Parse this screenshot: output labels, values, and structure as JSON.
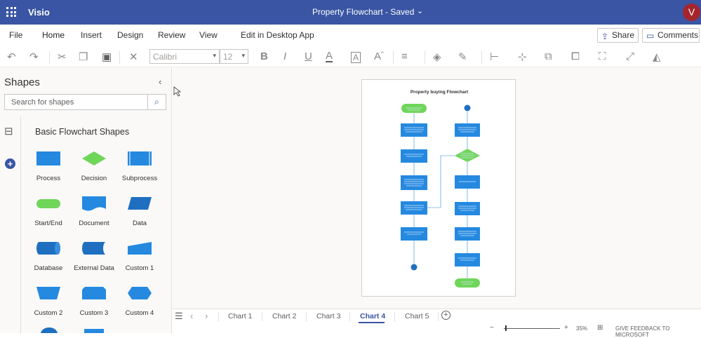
{
  "titlebar": {
    "app_name": "Visio",
    "doc_title": "Property Flowchart - Saved",
    "avatar_initial": "V",
    "avatar_color": "#a4262c",
    "bar_color": "#3955a3"
  },
  "menu": {
    "items": [
      "File",
      "Home",
      "Insert",
      "Design",
      "Review",
      "View",
      "Edit in Desktop App"
    ],
    "active": "Home",
    "share_label": "Share",
    "comments_label": "Comments"
  },
  "toolbar": {
    "font_name": "Calibri",
    "font_size": "12",
    "icons": [
      "undo-icon",
      "redo-icon",
      "cut-icon",
      "copy-icon",
      "paste-icon",
      "delete-icon",
      "bold-icon",
      "italic-icon",
      "underline-icon",
      "font-color-icon",
      "text-box-icon",
      "grow-font-icon",
      "align-icon",
      "fill-icon",
      "line-color-icon",
      "position-icon",
      "align-shapes-icon",
      "arrange-icon",
      "group-icon",
      "size-icon",
      "rotate-icon",
      "style-icon"
    ]
  },
  "sidebar": {
    "title": "Shapes",
    "search_placeholder": "Search for shapes",
    "stencil_title": "Basic Flowchart Shapes",
    "shapes": [
      {
        "label": "Process"
      },
      {
        "label": "Decision"
      },
      {
        "label": "Subprocess"
      },
      {
        "label": "Start/End"
      },
      {
        "label": "Document"
      },
      {
        "label": "Data"
      },
      {
        "label": "Database"
      },
      {
        "label": "External Data"
      },
      {
        "label": "Custom 1"
      },
      {
        "label": "Custom 2"
      },
      {
        "label": "Custom 3"
      },
      {
        "label": "Custom 4"
      }
    ]
  },
  "canvas": {
    "diagram_title": "Property buying Flowchart"
  },
  "tabs": {
    "items": [
      "Chart 1",
      "Chart 2",
      "Chart 3",
      "Chart 4",
      "Chart 5"
    ],
    "active": "Chart 4"
  },
  "status": {
    "zoom": "35%",
    "feedback": "GIVE FEEDBACK TO MICROSOFT",
    "zoom_out": "−",
    "zoom_in": "+"
  }
}
